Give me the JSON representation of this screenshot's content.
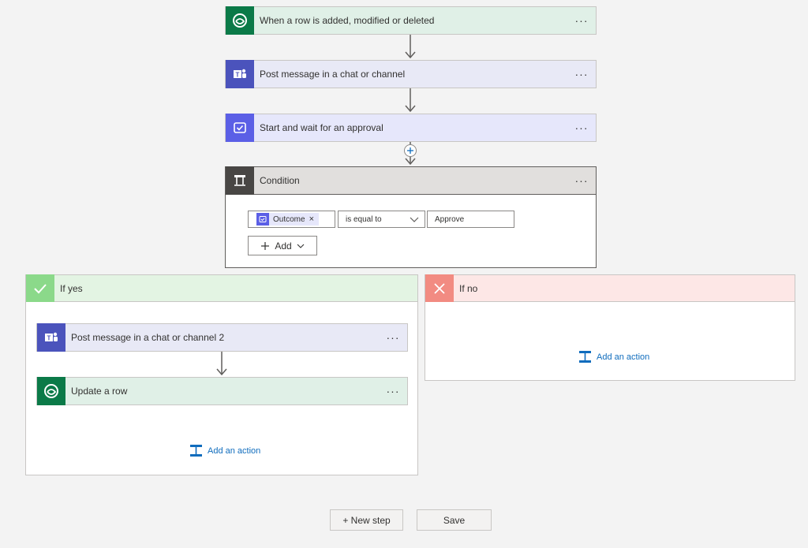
{
  "steps": {
    "trigger": {
      "title": "When a row is added, modified or deleted",
      "color": "#0b7a48",
      "bg": "#e0f0e7"
    },
    "teams_post": {
      "title": "Post message in a chat or channel",
      "color": "#4b53bc",
      "bg": "#e8e9f6"
    },
    "approval": {
      "title": "Start and wait for an approval",
      "color": "#5b5fe6",
      "bg": "#e6e7fb"
    }
  },
  "condition": {
    "title": "Condition",
    "header_color": "#484644",
    "token_label": "Outcome",
    "token_remove": "×",
    "operator": "is equal to",
    "value": "Approve",
    "add_label": "Add"
  },
  "if_yes": {
    "title": "If yes",
    "color": "#8bd98a",
    "steps": [
      {
        "title": "Post message in a chat or channel 2"
      },
      {
        "title": "Update a row"
      }
    ],
    "add_action": "Add an action"
  },
  "if_no": {
    "title": "If no",
    "color": "#f28b82",
    "add_action": "Add an action"
  },
  "more_label": "···",
  "footer": {
    "new_step": "+ New step",
    "save": "Save"
  }
}
